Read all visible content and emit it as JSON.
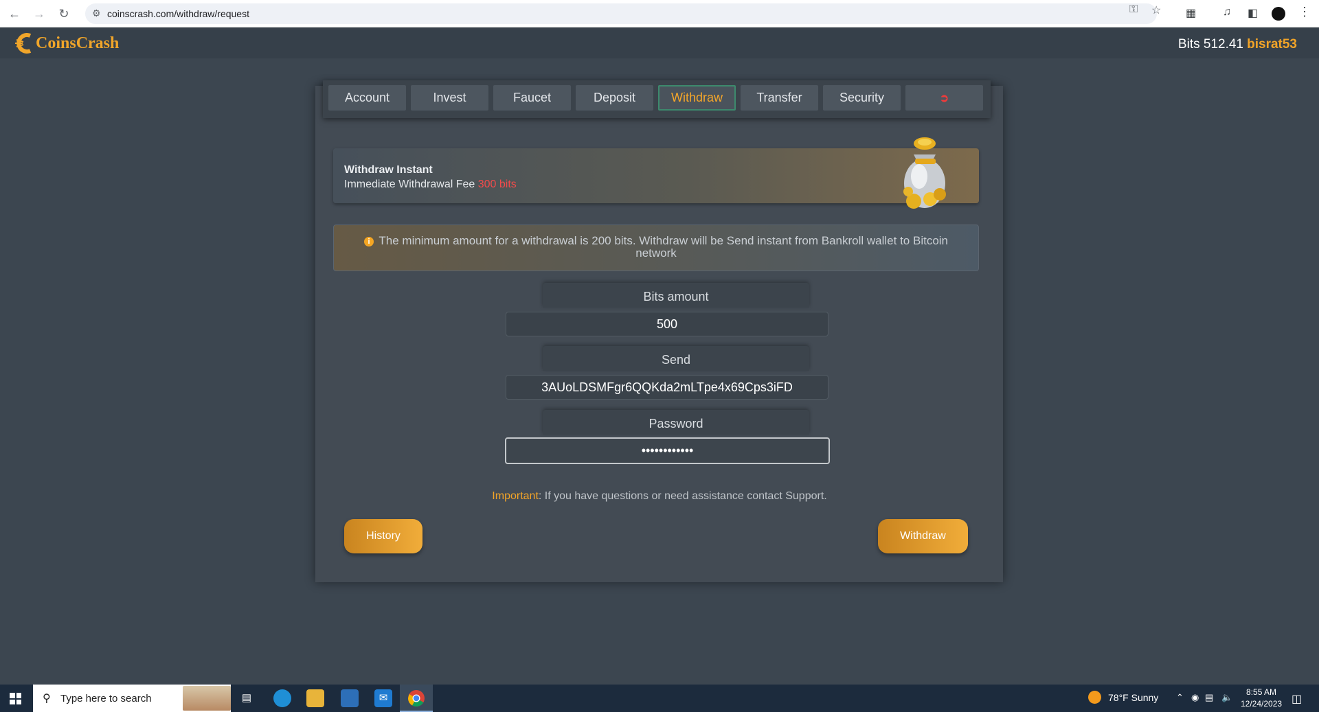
{
  "browser": {
    "url": "coinscrash.com/withdraw/request"
  },
  "header": {
    "logo_text": "CoinsCrash",
    "balance": "Bits 512.41",
    "username": "bisrat53"
  },
  "tabs": [
    {
      "label": "Account"
    },
    {
      "label": "Invest"
    },
    {
      "label": "Faucet"
    },
    {
      "label": "Deposit"
    },
    {
      "label": "Withdraw",
      "active": true
    },
    {
      "label": "Transfer"
    },
    {
      "label": "Security"
    },
    {
      "label": "",
      "icon": "sign-out-icon"
    }
  ],
  "withdraw_info": {
    "title": "Withdraw Instant",
    "fee_text": "Immediate Withdrawal Fee",
    "fee_value": "300 bits"
  },
  "notice": {
    "text": "The minimum amount for a withdrawal is 200 bits. Withdraw will be Send instant from Bankroll wallet to Bitcoin network"
  },
  "form": {
    "amount_label": "Bits amount",
    "amount_value": "500",
    "send_label": "Send",
    "send_value": "3AUoLDSMFgr6QQKda2mLTpe4x69Cps3iFD",
    "password_label": "Password",
    "password_value": "••••••••••••"
  },
  "important": {
    "label": "Important",
    "text": ": If you have questions or need assistance contact Support."
  },
  "buttons": {
    "history": "History",
    "withdraw": "Withdraw"
  },
  "taskbar": {
    "search_placeholder": "Type here to search",
    "weather": "78°F  Sunny",
    "time": "8:55 AM",
    "date": "12/24/2023"
  },
  "colors": {
    "accent": "#f2a428",
    "fee": "#f24b4b",
    "page_bg": "#3c4650"
  }
}
